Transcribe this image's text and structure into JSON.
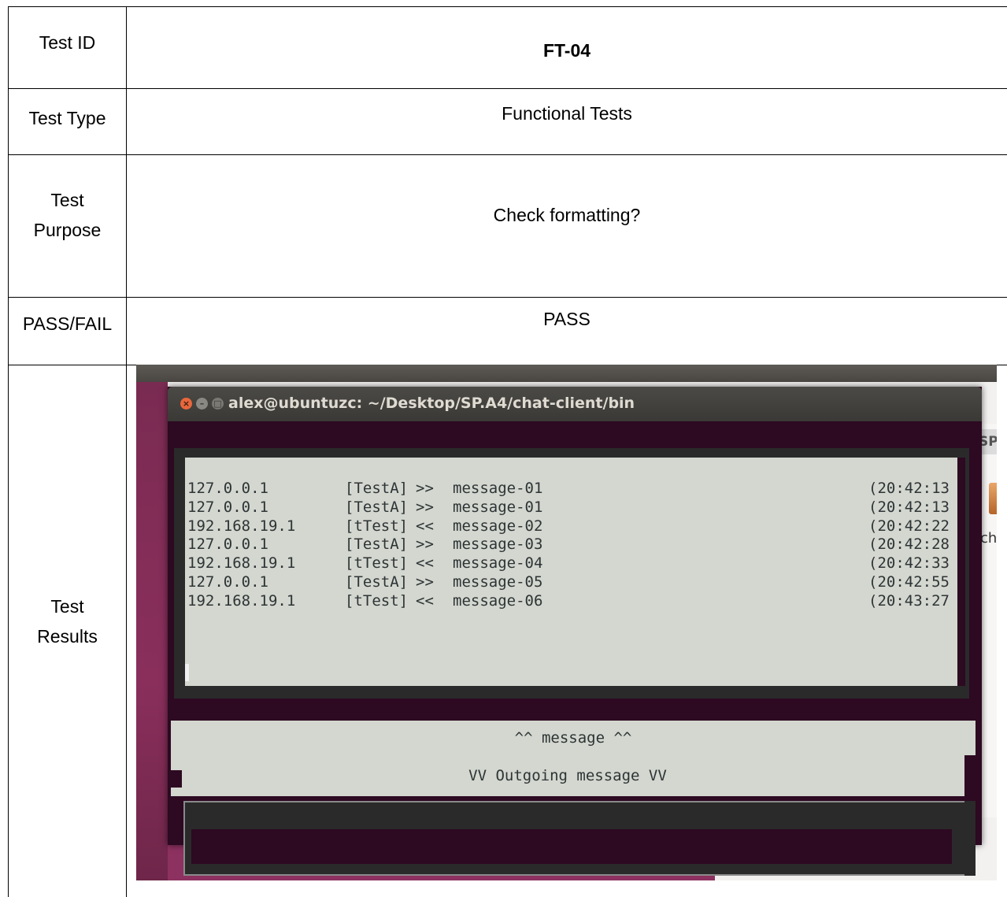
{
  "table": {
    "rows": [
      {
        "label": "Test ID",
        "value": "FT-04"
      },
      {
        "label": "Test Type",
        "value": "Functional Tests"
      },
      {
        "label": "Test Purpose",
        "value": "Check formatting?"
      },
      {
        "label": "PASS/FAIL",
        "value": "PASS"
      },
      {
        "label": "Test Results",
        "value": ""
      }
    ]
  },
  "screenshot": {
    "window_title": "alex@ubuntuzc: ~/Desktop/SP.A4/chat-client/bin",
    "side_tab_text": "SP",
    "side_text": "ch",
    "log": [
      {
        "ip": "127.0.0.1",
        "user": "[TestA]",
        "dir": ">>",
        "msg": "message-01",
        "time": "(20:42:13"
      },
      {
        "ip": "127.0.0.1",
        "user": "[TestA]",
        "dir": ">>",
        "msg": "message-01",
        "time": "(20:42:13"
      },
      {
        "ip": "192.168.19.1",
        "user": "[tTest]",
        "dir": "<<",
        "msg": "message-02",
        "time": "(20:42:22"
      },
      {
        "ip": "127.0.0.1",
        "user": "[TestA]",
        "dir": ">>",
        "msg": "message-03",
        "time": "(20:42:28"
      },
      {
        "ip": "192.168.19.1",
        "user": "[tTest]",
        "dir": "<<",
        "msg": "message-04",
        "time": "(20:42:33"
      },
      {
        "ip": "127.0.0.1",
        "user": "[TestA]",
        "dir": ">>",
        "msg": "message-05",
        "time": "(20:42:55"
      },
      {
        "ip": "192.168.19.1",
        "user": "[tTest]",
        "dir": "<<",
        "msg": "message-06",
        "time": "(20:43:27"
      }
    ],
    "divider_top": "^^ message ^^",
    "divider_bottom": "VV Outgoing message VV",
    "input_value": ""
  },
  "colors": {
    "terminal_bg": "#2d0922",
    "panel_bg": "#d3d7cf",
    "desktop": "#8a2f5c",
    "close_button": "#e9673b"
  }
}
